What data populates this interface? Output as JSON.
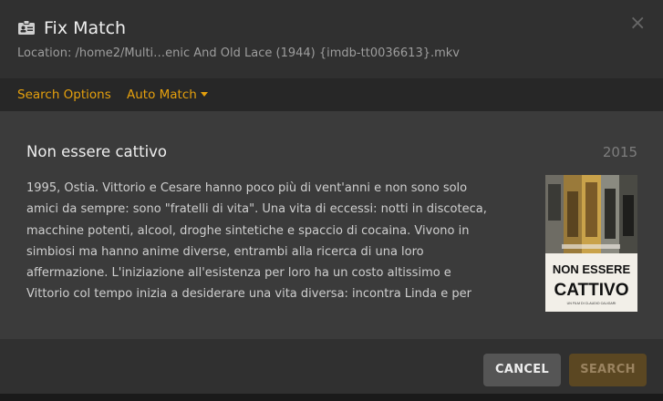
{
  "dialog": {
    "title": "Fix Match",
    "title_icon": "id-card-icon",
    "close_icon": "close-icon",
    "location_label": "Location: /home2/Multi…enic And Old Lace (1944) {imdb-tt0036613}.mkv"
  },
  "tabs": {
    "search_options": "Search Options",
    "auto_match": "Auto Match",
    "accent_color": "#e5a00d"
  },
  "result": {
    "title": "Non essere cattivo",
    "year": "2015",
    "summary": "1995, Ostia. Vittorio e Cesare hanno poco più di vent'anni e non sono solo amici da sempre: sono \"fratelli di vita\". Una vita di eccessi: notti in discoteca, macchine potenti, alcool, droghe sintetiche e spaccio di cocaina. Vivono in simbiosi ma hanno anime diverse, entrambi alla ricerca di una loro affermazione. L'iniziazione all'esistenza per loro ha un costo altissimo e Vittorio col tempo inizia a desiderare una vita diversa: incontra Linda e per",
    "poster": {
      "title_line1": "NON ESSERE",
      "title_line2": "CATTIVO",
      "credit": "UN FILM DI CLAUDIO CALIGARI"
    }
  },
  "footer": {
    "cancel_label": "CANCEL",
    "search_label": "SEARCH"
  }
}
